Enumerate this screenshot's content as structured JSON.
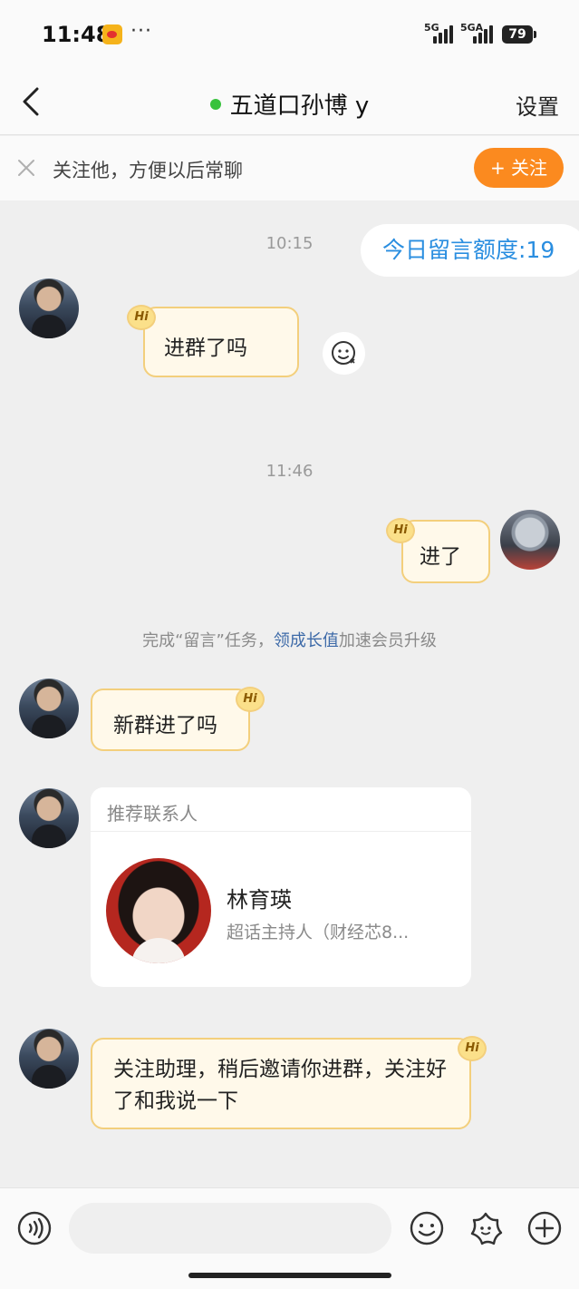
{
  "status_bar": {
    "time": "11:48",
    "dots": "···",
    "net1": "5G",
    "net2": "5GA",
    "battery": "79"
  },
  "nav": {
    "title": "五道口孙博 y",
    "settings_label": "设置"
  },
  "follow_banner": {
    "text": "关注他，方便以后常聊",
    "button_label": "+ 关注"
  },
  "quota": "今日留言额度:19",
  "messages": [
    {
      "time": "10:15",
      "text": "进群了吗",
      "from": "other",
      "badge": "Hi"
    },
    {
      "time": "11:46",
      "text": "进了",
      "from": "me",
      "badge": "Hi"
    },
    {
      "text": "新群进了吗",
      "from": "other",
      "badge": "Hi"
    },
    {
      "text": "关注助理，稍后邀请你进群，关注好了和我说一下",
      "from": "other",
      "badge": "Hi"
    }
  ],
  "task": {
    "before": "完成“留言”任务，",
    "link": "领成长值",
    "after": "加速会员升级"
  },
  "recommend": {
    "header": "推荐联系人",
    "name": "林育瑛",
    "desc": "超话主持人（财经芯8..."
  },
  "colors": {
    "accent_orange": "#fb8a1f",
    "quota_blue": "#2a8ee0",
    "bubble_bg": "#fff9ea",
    "bubble_border": "#f3cf7c",
    "online": "#37c23c"
  }
}
